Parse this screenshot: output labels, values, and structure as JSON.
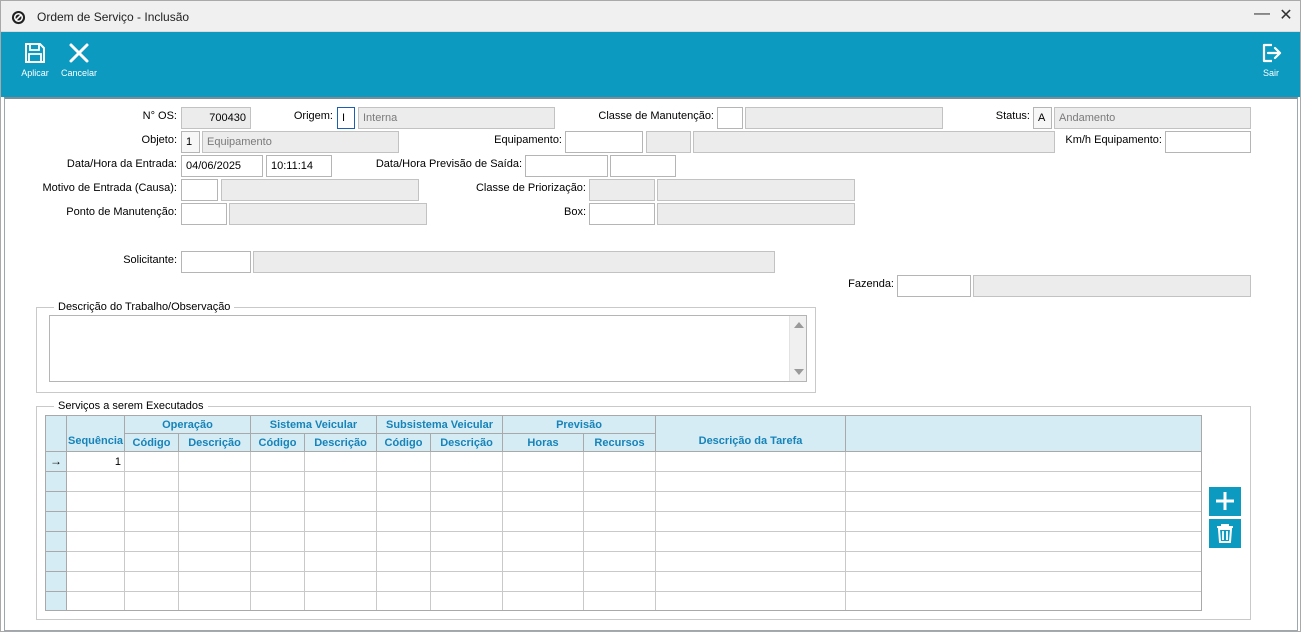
{
  "window": {
    "title": "Ordem de Serviço - Inclusão",
    "minimize": "—",
    "close": "✕"
  },
  "toolbar": {
    "apply_label": "Aplicar",
    "cancel_label": "Cancelar",
    "exit_label": "Sair"
  },
  "form": {
    "os_number": {
      "label": "N° OS:",
      "value": "700430"
    },
    "origem": {
      "label": "Origem:",
      "code": "I",
      "description": "Interna"
    },
    "classe_manutencao": {
      "label": "Classe de Manutenção:",
      "code": "",
      "description": ""
    },
    "status": {
      "label": "Status:",
      "code": "A",
      "description": "Andamento"
    },
    "objeto": {
      "label": "Objeto:",
      "code": "1",
      "description": "Equipamento"
    },
    "equipamento": {
      "label": "Equipamento:",
      "code": "",
      "extra": "",
      "description": ""
    },
    "kmh_equipamento": {
      "label": "Km/h Equipamento:",
      "value": ""
    },
    "data_entrada": {
      "label": "Data/Hora da Entrada:",
      "date": "04/06/2025",
      "time": "10:11:14"
    },
    "previsao_saida": {
      "label": "Data/Hora Previsão de Saída:",
      "date": "",
      "time": ""
    },
    "motivo_entrada": {
      "label": "Motivo de Entrada (Causa):",
      "code": "",
      "description": ""
    },
    "classe_priorizacao": {
      "label": "Classe de Priorização:",
      "code": "",
      "description": ""
    },
    "ponto_manutencao": {
      "label": "Ponto de Manutenção:",
      "code": "",
      "description": ""
    },
    "box": {
      "label": "Box:",
      "code": "",
      "description": ""
    },
    "solicitante": {
      "label": "Solicitante:",
      "code": "",
      "description": ""
    },
    "fazenda": {
      "label": "Fazenda:",
      "code": "",
      "description": ""
    }
  },
  "descricao": {
    "title": "Descrição do Trabalho/Observação",
    "value": ""
  },
  "servicos": {
    "title": "Serviços a serem Executados",
    "groups": {
      "operacao": "Operação",
      "sistema": "Sistema Veicular",
      "subsistema": "Subsistema Veicular",
      "previsao": "Previsão"
    },
    "columns": {
      "sequencia": "Sequência",
      "op_codigo": "Código",
      "op_descricao": "Descrição",
      "sis_codigo": "Código",
      "sis_descricao": "Descrição",
      "sub_codigo": "Código",
      "sub_descricao": "Descrição",
      "horas": "Horas",
      "recursos": "Recursos",
      "descricao_tarefa": "Descrição da Tarefa"
    },
    "rows": [
      {
        "indicator": "→",
        "sequencia": "1"
      },
      {
        "indicator": "",
        "sequencia": ""
      },
      {
        "indicator": "",
        "sequencia": ""
      },
      {
        "indicator": "",
        "sequencia": ""
      },
      {
        "indicator": "",
        "sequencia": ""
      },
      {
        "indicator": "",
        "sequencia": ""
      },
      {
        "indicator": "",
        "sequencia": ""
      },
      {
        "indicator": "",
        "sequencia": ""
      }
    ],
    "add_button": "plus-icon",
    "delete_button": "trash-icon"
  },
  "colors": {
    "accent": "#0c9ac1",
    "grid_header_bg": "#d5ecf4",
    "grid_header_text": "#1683b9",
    "readonly_bg": "#ececec"
  }
}
